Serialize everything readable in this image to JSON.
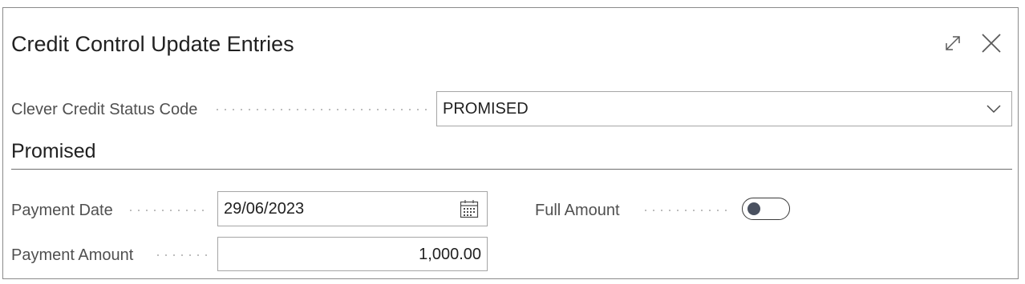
{
  "dialog": {
    "title": "Credit Control Update Entries",
    "expand_icon": "expand-icon",
    "close_icon": "close-icon"
  },
  "status_field": {
    "label": "Clever Credit Status Code",
    "value": "PROMISED",
    "icon": "chevron-down-icon"
  },
  "section": {
    "title": "Promised"
  },
  "payment_date": {
    "label": "Payment Date",
    "value": "29/06/2023",
    "icon": "calendar-icon"
  },
  "payment_amount": {
    "label": "Payment Amount",
    "value": "1,000.00"
  },
  "full_amount": {
    "label": "Full Amount",
    "checked": false
  },
  "colors": {
    "border": "#a6a6a6",
    "text": "#212121",
    "label": "#505050",
    "toggle_knob": "#4a5160"
  }
}
